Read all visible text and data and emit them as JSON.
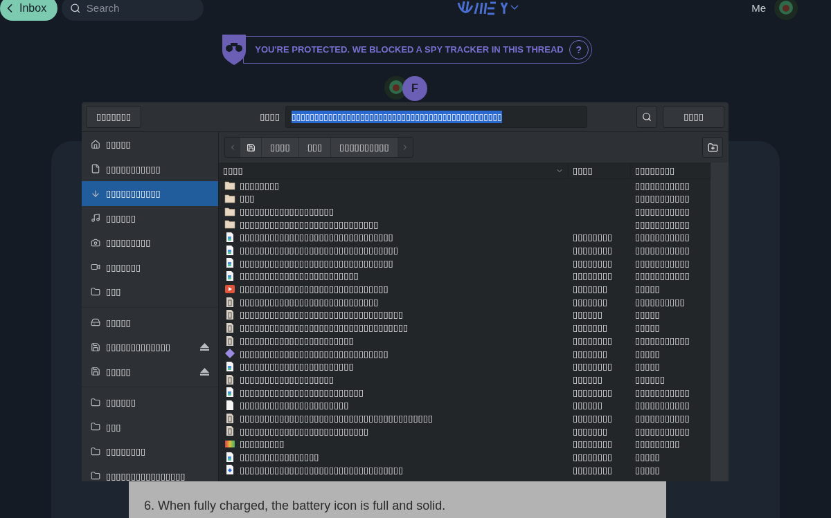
{
  "topbar": {
    "back_button": "Inbox",
    "search_placeholder": "Search",
    "user_label": "Me"
  },
  "banner": {
    "text": "YOU'RE PROTECTED. WE BLOCKED A SPY TRACKER IN THIS THREAD",
    "help": "?"
  },
  "participants": [
    {
      "kind": "image"
    },
    {
      "kind": "initial",
      "initial": "F"
    }
  ],
  "message_text": "6. When fully charged, the battery icon is full and solid.",
  "dialog": {
    "cancel_button": "▯▯▯▯▯▯▯",
    "name_label": "▯▯▯▯",
    "name_value": "▯▯▯▯▯▯▯▯▯▯▯▯▯▯▯▯▯▯▯▯▯▯▯▯▯▯▯▯▯▯▯▯▯▯▯▯▯▯▯▯▯▯▯▯▯▯",
    "save_button": "▯▯▯▯",
    "places": [
      {
        "kind": "home",
        "label": "▯▯▯▯▯",
        "selected": false
      },
      {
        "kind": "file",
        "label": "▯▯▯▯▯▯▯▯▯▯▯",
        "selected": false
      },
      {
        "kind": "download",
        "label": "▯▯▯▯▯▯▯▯▯▯▯",
        "selected": true
      },
      {
        "kind": "music",
        "label": "▯▯▯▯▯▯",
        "selected": false
      },
      {
        "kind": "camera",
        "label": "▯▯▯▯▯▯▯▯▯",
        "selected": false
      },
      {
        "kind": "video",
        "label": "▯▯▯▯▯▯▯",
        "selected": false
      },
      {
        "kind": "folder",
        "label": "▯▯▯",
        "selected": false
      },
      {
        "kind": "separator"
      },
      {
        "kind": "drive",
        "label": "▯▯▯▯▯",
        "selected": false
      },
      {
        "kind": "disk",
        "label": "▯▯▯▯▯▯▯▯▯▯▯▯▯",
        "selected": false,
        "eject": true
      },
      {
        "kind": "disk",
        "label": "▯▯▯▯▯",
        "selected": false,
        "eject": true
      },
      {
        "kind": "separator"
      },
      {
        "kind": "folder",
        "label": "▯▯▯▯▯▯",
        "selected": false
      },
      {
        "kind": "folder",
        "label": "▯▯▯",
        "selected": false
      },
      {
        "kind": "folder",
        "label": "▯▯▯▯▯▯▯▯",
        "selected": false
      },
      {
        "kind": "folder",
        "label": "▯▯▯▯▯▯▯▯▯▯▯▯▯▯▯▯",
        "selected": false
      }
    ],
    "path": [
      "▯▯▯▯",
      "▯▯▯",
      "▯▯▯▯▯▯▯▯▯▯"
    ],
    "columns": [
      {
        "label": "▯▯▯▯",
        "sorted": true
      },
      {
        "label": "▯▯▯▯",
        "sorted": false
      },
      {
        "label": "▯▯▯▯▯▯▯▯",
        "sorted": false
      }
    ],
    "files": [
      {
        "kind": "folder",
        "name": "▯▯▯▯▯▯▯▯",
        "modified": "▯▯▯▯▯▯▯▯▯▯▯"
      },
      {
        "kind": "folder",
        "name": "▯▯▯",
        "modified": "▯▯▯▯▯▯▯▯▯▯▯"
      },
      {
        "kind": "folder",
        "name": "▯▯▯▯▯▯▯▯▯▯▯▯▯▯▯▯▯▯▯",
        "modified": "▯▯▯▯▯▯▯▯▯▯▯"
      },
      {
        "kind": "folder",
        "name": "▯▯▯▯▯▯▯▯▯▯▯▯▯▯▯▯▯▯▯▯▯▯▯▯▯▯▯▯",
        "modified": "▯▯▯▯▯▯▯▯▯▯▯"
      },
      {
        "kind": "image",
        "name": "▯▯▯▯▯▯▯▯▯▯▯▯▯▯▯▯▯▯▯▯▯▯▯▯▯▯▯▯▯▯▯",
        "size": "▯▯▯▯▯▯▯▯",
        "modified": "▯▯▯▯▯▯▯▯▯▯▯"
      },
      {
        "kind": "image",
        "name": "▯▯▯▯▯▯▯▯▯▯▯▯▯▯▯▯▯▯▯▯▯▯▯▯▯▯▯▯▯▯▯▯",
        "size": "▯▯▯▯▯▯▯▯",
        "modified": "▯▯▯▯▯▯▯▯▯▯▯"
      },
      {
        "kind": "image",
        "name": "▯▯▯▯▯▯▯▯▯▯▯▯▯▯▯▯▯▯▯▯▯▯▯▯▯▯▯▯▯▯▯",
        "size": "▯▯▯▯▯▯▯▯",
        "modified": "▯▯▯▯▯▯▯▯▯▯▯"
      },
      {
        "kind": "image",
        "name": "▯▯▯▯▯▯▯▯▯▯▯▯▯▯▯▯▯▯▯▯▯▯▯▯",
        "size": "▯▯▯▯▯▯▯▯",
        "modified": "▯▯▯▯▯▯▯▯▯▯▯"
      },
      {
        "kind": "video",
        "name": "▯▯▯▯▯▯▯▯▯▯▯▯▯▯▯▯▯▯▯▯▯▯▯▯▯▯▯▯▯▯",
        "size": "▯▯▯▯▯▯▯",
        "modified": "▯▯▯▯▯"
      },
      {
        "kind": "archive",
        "name": "▯▯▯▯▯▯▯▯▯▯▯▯▯▯▯▯▯▯▯▯▯▯▯▯▯▯▯▯",
        "size": "▯▯▯▯▯▯▯",
        "modified": "▯▯▯▯▯▯▯▯▯▯"
      },
      {
        "kind": "archive",
        "name": "▯▯▯▯▯▯▯▯▯▯▯▯▯▯▯▯▯▯▯▯▯▯▯▯▯▯▯▯▯▯▯▯▯",
        "size": "▯▯▯▯▯▯",
        "modified": "▯▯▯▯▯"
      },
      {
        "kind": "archive",
        "name": "▯▯▯▯▯▯▯▯▯▯▯▯▯▯▯▯▯▯▯▯▯▯▯▯▯▯▯▯▯▯▯▯▯▯",
        "size": "▯▯▯▯▯▯▯",
        "modified": "▯▯▯▯▯"
      },
      {
        "kind": "archive",
        "name": "▯▯▯▯▯▯▯▯▯▯▯▯▯▯▯▯▯▯▯▯▯▯▯",
        "size": "▯▯▯▯▯▯▯▯",
        "modified": "▯▯▯▯▯▯▯▯▯▯▯"
      },
      {
        "kind": "diamond",
        "name": "▯▯▯▯▯▯▯▯▯▯▯▯▯▯▯▯▯▯▯▯▯▯▯▯▯▯▯▯▯▯",
        "size": "▯▯▯▯▯▯▯",
        "modified": "▯▯▯▯▯"
      },
      {
        "kind": "image",
        "name": "▯▯▯▯▯▯▯▯▯▯▯▯▯▯▯▯▯▯▯▯▯▯▯",
        "size": "▯▯▯▯▯▯▯▯",
        "modified": "▯▯▯▯▯"
      },
      {
        "kind": "archive",
        "name": "▯▯▯▯▯▯▯▯▯▯▯▯▯▯▯▯▯▯▯",
        "size": "▯▯▯▯▯▯",
        "modified": "▯▯▯▯▯▯"
      },
      {
        "kind": "image",
        "name": "▯▯▯▯▯▯▯▯▯▯▯▯▯▯▯▯▯▯▯▯▯▯▯▯▯",
        "size": "▯▯▯▯▯▯▯▯",
        "modified": "▯▯▯▯▯▯▯▯▯▯▯"
      },
      {
        "kind": "blank",
        "name": "▯▯▯▯▯▯▯▯▯▯▯▯▯▯▯▯▯▯▯▯▯▯",
        "size": "▯▯▯▯▯▯",
        "modified": "▯▯▯▯▯▯▯▯▯▯▯"
      },
      {
        "kind": "archive",
        "name": "▯▯▯▯▯▯▯▯▯▯▯▯▯▯▯▯▯▯▯▯▯▯▯▯▯▯▯▯▯▯▯▯▯▯▯▯▯▯▯",
        "size": "▯▯▯▯▯▯▯▯",
        "modified": "▯▯▯▯▯▯▯▯▯▯▯"
      },
      {
        "kind": "archive",
        "name": "▯▯▯▯▯▯▯▯▯▯▯▯▯▯▯▯▯▯▯▯▯▯▯▯▯▯",
        "size": "▯▯▯▯▯▯▯",
        "modified": "▯▯▯▯▯▯▯▯▯▯▯"
      },
      {
        "kind": "gradient",
        "name": "▯▯▯▯▯▯▯▯▯",
        "size": "▯▯▯▯▯▯▯▯",
        "modified": "▯▯▯▯▯▯▯▯▯"
      },
      {
        "kind": "image",
        "name": "▯▯▯▯▯▯▯▯▯▯▯▯▯▯▯▯",
        "size": "▯▯▯▯▯▯▯▯",
        "modified": "▯▯▯▯▯"
      },
      {
        "kind": "bluedoc",
        "name": "▯▯▯▯▯▯▯▯▯▯▯▯▯▯▯▯▯▯▯▯▯▯▯▯▯▯▯▯▯▯▯▯▯",
        "size": "▯▯▯▯▯▯▯▯",
        "modified": "▯▯▯▯▯"
      }
    ]
  }
}
